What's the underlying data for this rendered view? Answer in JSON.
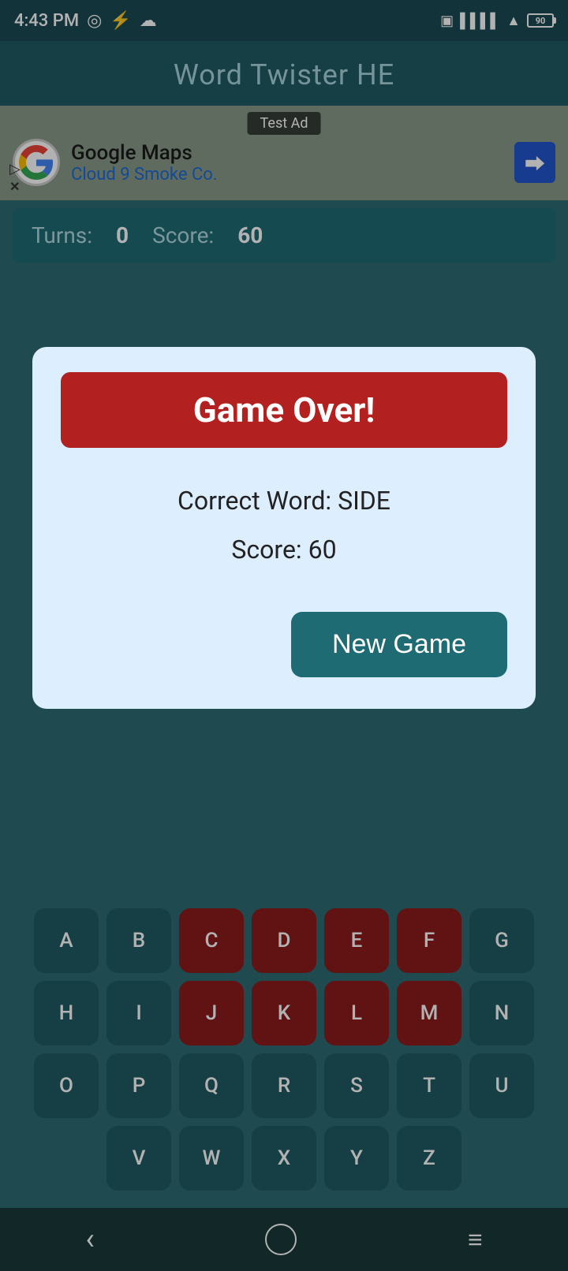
{
  "statusBar": {
    "time": "4:43 PM",
    "battery": "90"
  },
  "header": {
    "title": "Word Twister HE"
  },
  "ad": {
    "label": "Test Ad",
    "company": "Google Maps",
    "subtitle": "Cloud 9 Smoke Co."
  },
  "stats": {
    "turnsLabel": "Turns:",
    "turnsValue": "0",
    "scoreLabel": "Score:",
    "scoreValue": "60"
  },
  "modal": {
    "gameOverLabel": "Game Over!",
    "correctWordLabel": "Correct Word: SIDE",
    "scoreLabel": "Score: 60",
    "newGameLabel": "New Game"
  },
  "keyboard": {
    "rows": [
      [
        "A",
        "B",
        "C",
        "D",
        "E",
        "F",
        "G"
      ],
      [
        "H",
        "I",
        "J",
        "K",
        "L",
        "M",
        "N"
      ],
      [
        "O",
        "P",
        "Q",
        "R",
        "S",
        "T",
        "U"
      ],
      [
        "V",
        "W",
        "X",
        "Y",
        "Z"
      ]
    ],
    "usedKeys": [
      "C",
      "D",
      "E",
      "F",
      "J",
      "K",
      "L",
      "M"
    ]
  },
  "bottomNav": {
    "back": "‹",
    "home": "○",
    "menu": "≡"
  }
}
